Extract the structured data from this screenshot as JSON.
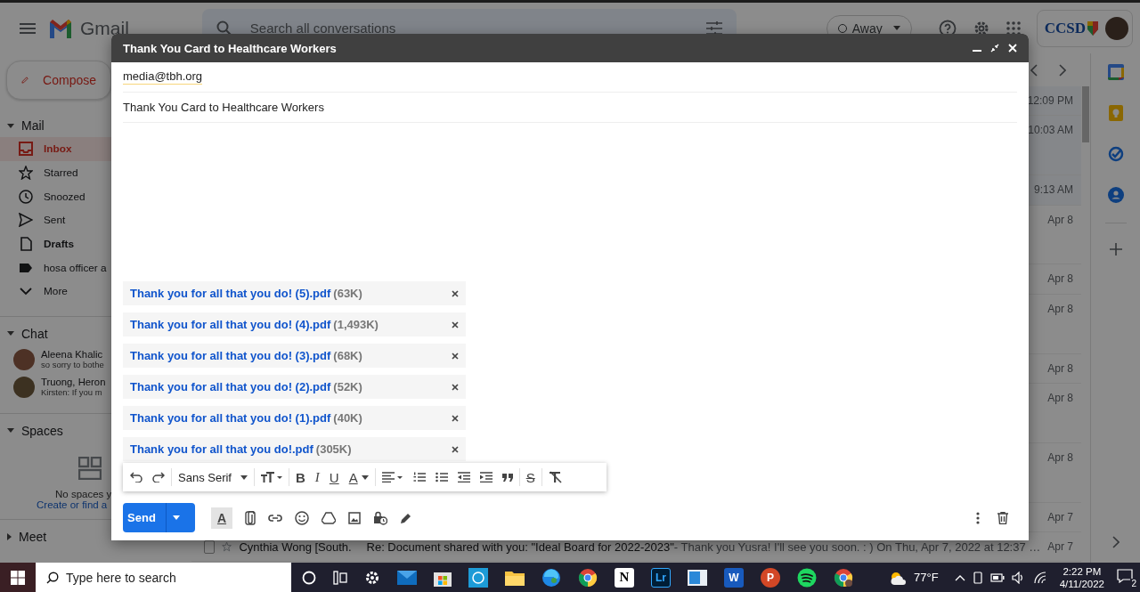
{
  "header": {
    "product": "Gmail",
    "search_placeholder": "Search all conversations",
    "status": "Away",
    "org_logo": "CCSD"
  },
  "sidebar": {
    "compose": "Compose",
    "mail_title": "Mail",
    "items": [
      {
        "label": "Inbox",
        "selected": true,
        "bold": true
      },
      {
        "label": "Starred",
        "selected": false,
        "bold": false
      },
      {
        "label": "Snoozed",
        "selected": false,
        "bold": false
      },
      {
        "label": "Sent",
        "selected": false,
        "bold": false
      },
      {
        "label": "Drafts",
        "selected": false,
        "bold": true
      },
      {
        "label": "hosa officer a",
        "selected": false,
        "bold": false
      },
      {
        "label": "More",
        "selected": false,
        "bold": false
      }
    ],
    "chat_title": "Chat",
    "chats": [
      {
        "name": "Aleena Khalic",
        "snippet": "so sorry to bothe"
      },
      {
        "name": "Truong, Heron",
        "snippet": "Kirsten: If you m"
      }
    ],
    "spaces_title": "Spaces",
    "spaces_empty": "No spaces y",
    "spaces_link": "Create or find a",
    "meet_title": "Meet"
  },
  "mail_list": {
    "rows": [
      {
        "kind": "single",
        "time": "12:09 PM"
      },
      {
        "kind": "double",
        "time": "10:03 AM"
      },
      {
        "kind": "single",
        "time": "9:13 AM"
      },
      {
        "kind": "double",
        "time": "Apr 8"
      },
      {
        "kind": "single",
        "time": "Apr 8"
      },
      {
        "kind": "double",
        "time": "Apr 8"
      },
      {
        "kind": "single",
        "time": "Apr 8"
      },
      {
        "kind": "double",
        "time": "Apr 8"
      },
      {
        "kind": "double",
        "time": "Apr 8"
      },
      {
        "kind": "single",
        "time": "Apr 7"
      },
      {
        "kind": "single",
        "time": "Apr 7",
        "checked": false,
        "sender": "Cynthia Wong [South.",
        "subject": "Re: Document shared with you: \"Ideal Board for 2022-2023\"",
        "snippet": " - Thank you Yusra! I'll see you soon. : ) On Thu, Apr 7, 2022 at 12:37 …"
      }
    ]
  },
  "compose": {
    "title": "Thank You Card to Healthcare Workers",
    "to": "media@tbh.org",
    "subject": "Thank You Card to Healthcare Workers",
    "attachments": [
      {
        "name": "Thank you for all that you do! (5).pdf",
        "size": "(63K)"
      },
      {
        "name": "Thank you for all that you do! (4).pdf",
        "size": "(1,493K)"
      },
      {
        "name": "Thank you for all that you do! (3).pdf",
        "size": "(68K)"
      },
      {
        "name": "Thank you for all that you do! (2).pdf",
        "size": "(52K)"
      },
      {
        "name": "Thank you for all that you do! (1).pdf",
        "size": "(40K)"
      },
      {
        "name": "Thank you for all that you do!.pdf",
        "size": "(305K)"
      }
    ],
    "toolbar": {
      "font": "Sans Serif",
      "bold": "B",
      "italic": "I",
      "underline": "U",
      "text_color": "A",
      "strikethrough": "S"
    },
    "formatting_toggle": "A",
    "send": "Send"
  },
  "taskbar": {
    "search_placeholder": "Type here to search",
    "apps": [
      {
        "kind": "cortana"
      },
      {
        "kind": "taskview"
      },
      {
        "kind": "settings"
      },
      {
        "kind": "mail"
      },
      {
        "kind": "store"
      },
      {
        "kind": "calc"
      },
      {
        "kind": "folder"
      },
      {
        "kind": "edge"
      },
      {
        "kind": "chrome"
      },
      {
        "kind": "notion",
        "glyph": "N"
      },
      {
        "kind": "lightroom",
        "glyph": "Lr"
      },
      {
        "kind": "whiteboard"
      },
      {
        "kind": "word",
        "glyph": "W"
      },
      {
        "kind": "powerpoint",
        "glyph": "P"
      },
      {
        "kind": "spotify"
      },
      {
        "kind": "chrome-profile"
      }
    ],
    "weather": "77°F",
    "time": "2:22 PM",
    "date": "4/11/2022",
    "notifications": "2"
  }
}
